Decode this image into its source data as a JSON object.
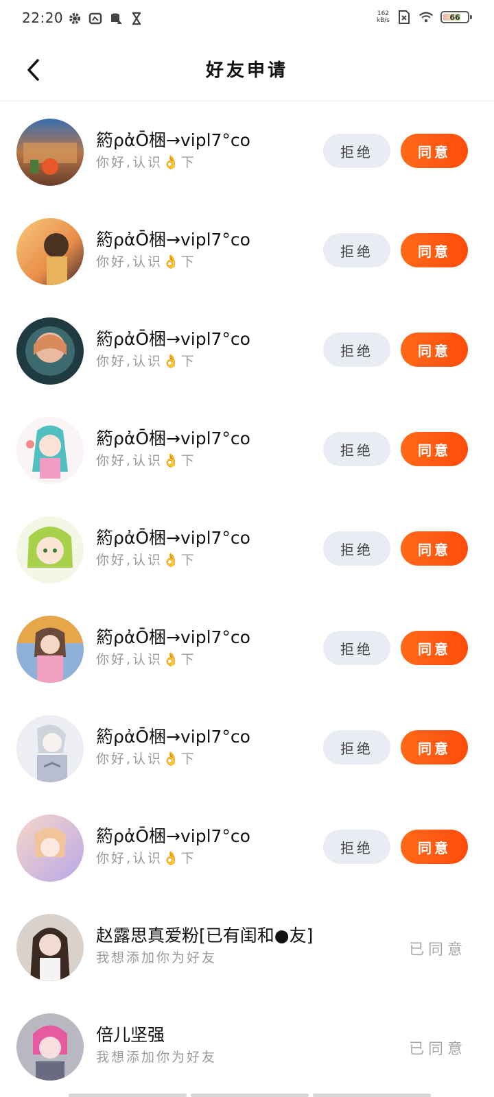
{
  "status_bar": {
    "time": "22:20",
    "net_speed_value": "162",
    "net_speed_unit": "kB/s",
    "battery": "66",
    "icons": [
      "gear-icon",
      "gallery-icon",
      "database-icon",
      "hourglass-icon",
      "no-sim-icon",
      "wifi-icon",
      "battery-icon"
    ]
  },
  "header": {
    "title": "好友申请",
    "back_icon": "chevron-left-icon"
  },
  "requests": [
    {
      "name": "箹ρἀŌ梱→vipl7°co",
      "message": "你好,认识👌下",
      "reject_label": "拒绝",
      "accept_label": "同意"
    },
    {
      "name": "箹ρἀŌ梱→vipl7°co",
      "message": "你好,认识👌下",
      "reject_label": "拒绝",
      "accept_label": "同意"
    },
    {
      "name": "箹ρἀŌ梱→vipl7°co",
      "message": "你好,认识👌下",
      "reject_label": "拒绝",
      "accept_label": "同意"
    },
    {
      "name": "箹ρἀŌ梱→vipl7°co",
      "message": "你好,认识👌下",
      "reject_label": "拒绝",
      "accept_label": "同意"
    },
    {
      "name": "箹ρἀŌ梱→vipl7°co",
      "message": "你好,认识👌下",
      "reject_label": "拒绝",
      "accept_label": "同意"
    },
    {
      "name": "箹ρἀŌ梱→vipl7°co",
      "message": "你好,认识👌下",
      "reject_label": "拒绝",
      "accept_label": "同意"
    },
    {
      "name": "箹ρἀŌ梱→vipl7°co",
      "message": "你好,认识👌下",
      "reject_label": "拒绝",
      "accept_label": "同意"
    },
    {
      "name": "箹ρἀŌ梱→vipl7°co",
      "message": "你好,认识👌下",
      "reject_label": "拒绝",
      "accept_label": "同意"
    }
  ],
  "accepted_requests": [
    {
      "name": "赵露思真爱粉[已有闺和●友]",
      "message": "我想添加你为好友",
      "status": "已同意"
    },
    {
      "name": "倍儿坚强",
      "message": "我想添加你为好友",
      "status": "已同意"
    }
  ],
  "colors": {
    "accept_button": "#ff5a12",
    "reject_button": "#e9edf3",
    "secondary_text": "#9a9a9a",
    "accepted_text": "#a9a9a9"
  }
}
